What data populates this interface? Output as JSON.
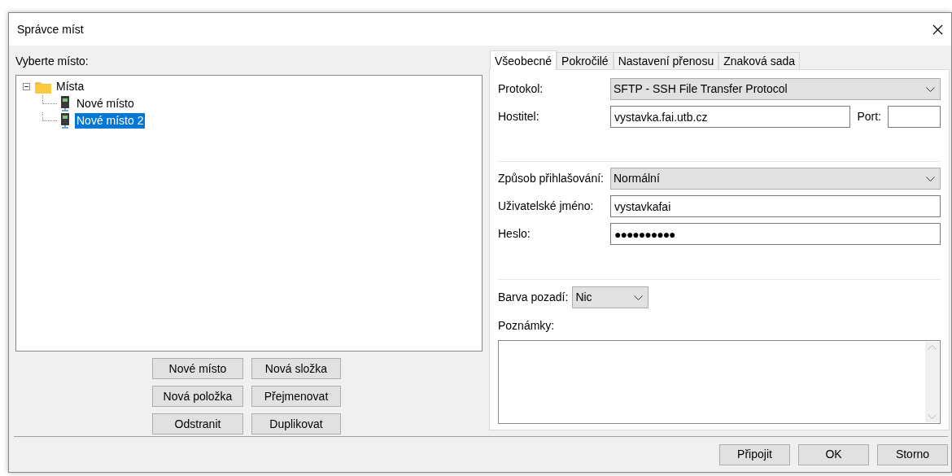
{
  "window": {
    "title": "Správce míst"
  },
  "tree_label": "Vyberte místo:",
  "tree": [
    {
      "label": "Místa",
      "kind": "folder",
      "expanded": true,
      "selected": false,
      "children": [
        {
          "label": "Nové místo",
          "kind": "site",
          "selected": false
        },
        {
          "label": "Nové místo 2",
          "kind": "site",
          "selected": true
        }
      ]
    }
  ],
  "tree_buttons": [
    [
      "Nové místo",
      "Nová složka"
    ],
    [
      "Nová položka",
      "Přejmenovat"
    ],
    [
      "Odstranit",
      "Duplikovat"
    ]
  ],
  "tabs": [
    {
      "label": "Všeobecné",
      "selected": true
    },
    {
      "label": "Pokročilé",
      "selected": false
    },
    {
      "label": "Nastavení přenosu",
      "selected": false
    },
    {
      "label": "Znaková sada",
      "selected": false
    }
  ],
  "general": {
    "protocol": {
      "label": "Protokol:",
      "value": "SFTP - SSH File Transfer Protocol"
    },
    "host": {
      "label": "Hostitel:",
      "value": "vystavka.fai.utb.cz"
    },
    "port": {
      "label": "Port:"
    },
    "logon_type": {
      "label": "Způsob přihlašování:",
      "value": "Normální"
    },
    "user": {
      "label": "Uživatelské jméno:",
      "value": "vystavkafai"
    },
    "password": {
      "label": "Heslo:",
      "value": "●●●●●●●●●●"
    },
    "background_color": {
      "label": "Barva pozadí:",
      "value": "Nic"
    },
    "comments": {
      "label": "Poznámky:"
    }
  },
  "buttons": [
    "Připojit",
    "OK",
    "Storno"
  ]
}
